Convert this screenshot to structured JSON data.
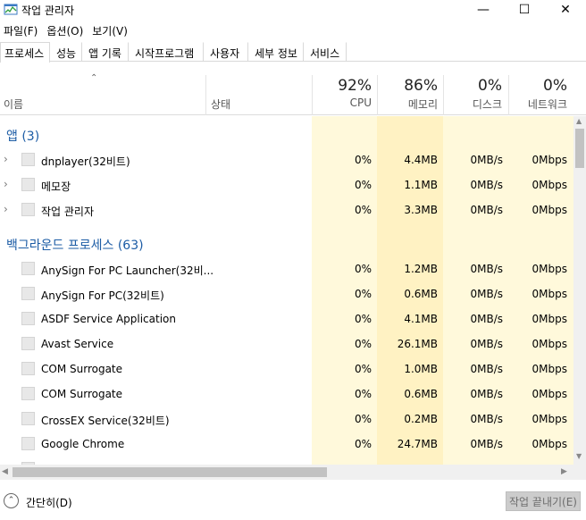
{
  "window": {
    "title": "작업 관리자",
    "min_glyph": "—",
    "max_glyph": "☐",
    "close_glyph": "✕"
  },
  "menu": [
    "파일(F)",
    "옵션(O)",
    "보기(V)"
  ],
  "tabs": [
    "프로세스",
    "성능",
    "앱 기록",
    "시작프로그램",
    "사용자",
    "세부 정보",
    "서비스"
  ],
  "active_tab": "프로세스",
  "columns": {
    "name": "이름",
    "status": "상태",
    "cpu": {
      "pct": "92%",
      "label": "CPU"
    },
    "memory": {
      "pct": "86%",
      "label": "메모리"
    },
    "disk": {
      "pct": "0%",
      "label": "디스크"
    },
    "network": {
      "pct": "0%",
      "label": "네트워크"
    }
  },
  "groups": {
    "apps": {
      "title": "앱 (3)",
      "rows": [
        {
          "name": "dnplayer(32비트)",
          "cpu": "0%",
          "mem": "4.4MB",
          "disk": "0MB/s",
          "net": "0Mbps"
        },
        {
          "name": "메모장",
          "cpu": "0%",
          "mem": "1.1MB",
          "disk": "0MB/s",
          "net": "0Mbps"
        },
        {
          "name": "작업 관리자",
          "cpu": "0%",
          "mem": "3.3MB",
          "disk": "0MB/s",
          "net": "0Mbps"
        }
      ]
    },
    "background": {
      "title": "백그라운드 프로세스 (63)",
      "rows": [
        {
          "name": "AnySign For PC Launcher(32비...",
          "cpu": "0%",
          "mem": "1.2MB",
          "disk": "0MB/s",
          "net": "0Mbps"
        },
        {
          "name": "AnySign For PC(32비트)",
          "cpu": "0%",
          "mem": "0.6MB",
          "disk": "0MB/s",
          "net": "0Mbps"
        },
        {
          "name": "ASDF Service Application",
          "cpu": "0%",
          "mem": "4.1MB",
          "disk": "0MB/s",
          "net": "0Mbps"
        },
        {
          "name": "Avast Service",
          "cpu": "0%",
          "mem": "26.1MB",
          "disk": "0MB/s",
          "net": "0Mbps"
        },
        {
          "name": "COM Surrogate",
          "cpu": "0%",
          "mem": "1.0MB",
          "disk": "0MB/s",
          "net": "0Mbps"
        },
        {
          "name": "COM Surrogate",
          "cpu": "0%",
          "mem": "0.6MB",
          "disk": "0MB/s",
          "net": "0Mbps"
        },
        {
          "name": "CrossEX Service(32비트)",
          "cpu": "0%",
          "mem": "0.2MB",
          "disk": "0MB/s",
          "net": "0Mbps"
        },
        {
          "name": "Google Chrome",
          "cpu": "0%",
          "mem": "24.7MB",
          "disk": "0MB/s",
          "net": "0Mbps"
        }
      ]
    }
  },
  "footer": {
    "fewer_details": "간단히(D)",
    "end_task": "작업 끝내기(E)"
  },
  "colors": {
    "cpu_column_bg": "#fff9db",
    "memory_column_bg": "#fff2c3",
    "group_title": "#1c5ca5"
  },
  "icons": {
    "app": "task-manager-icon",
    "expander": "chevron-right-icon",
    "sort": "sort-up-icon",
    "fewer": "chevron-up-circle-icon"
  }
}
